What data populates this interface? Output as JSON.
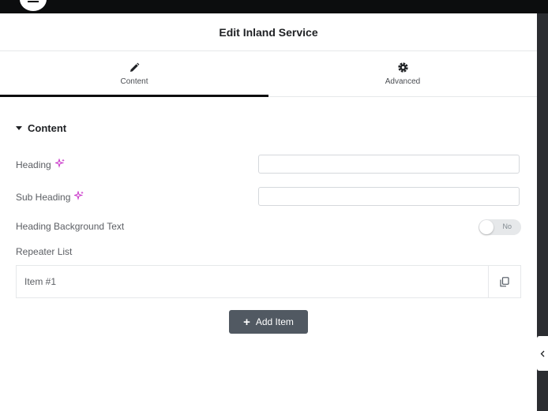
{
  "panel": {
    "title": "Edit Inland Service"
  },
  "tabs": [
    {
      "label": "Content",
      "icon": "pencil-icon",
      "active": true
    },
    {
      "label": "Advanced",
      "icon": "gear-icon",
      "active": false
    }
  ],
  "section": {
    "title": "Content",
    "icon": "caret-down-icon"
  },
  "fields": {
    "heading": {
      "label": "Heading",
      "value": "",
      "icon": "ai-sparkle-icon"
    },
    "sub_heading": {
      "label": "Sub Heading",
      "value": "",
      "icon": "ai-sparkle-icon"
    },
    "heading_background_text": {
      "label": "Heading Background Text",
      "toggle_text": "No",
      "enabled": false
    }
  },
  "repeater": {
    "label": "Repeater List",
    "items": [
      {
        "title": "Item #1"
      }
    ],
    "duplicate_icon": "copy-icon",
    "add_label": "Add Item"
  },
  "colors": {
    "accent_ai": "#c935c9",
    "button_bg": "#515962",
    "dark_bar": "#0c0d0e"
  }
}
